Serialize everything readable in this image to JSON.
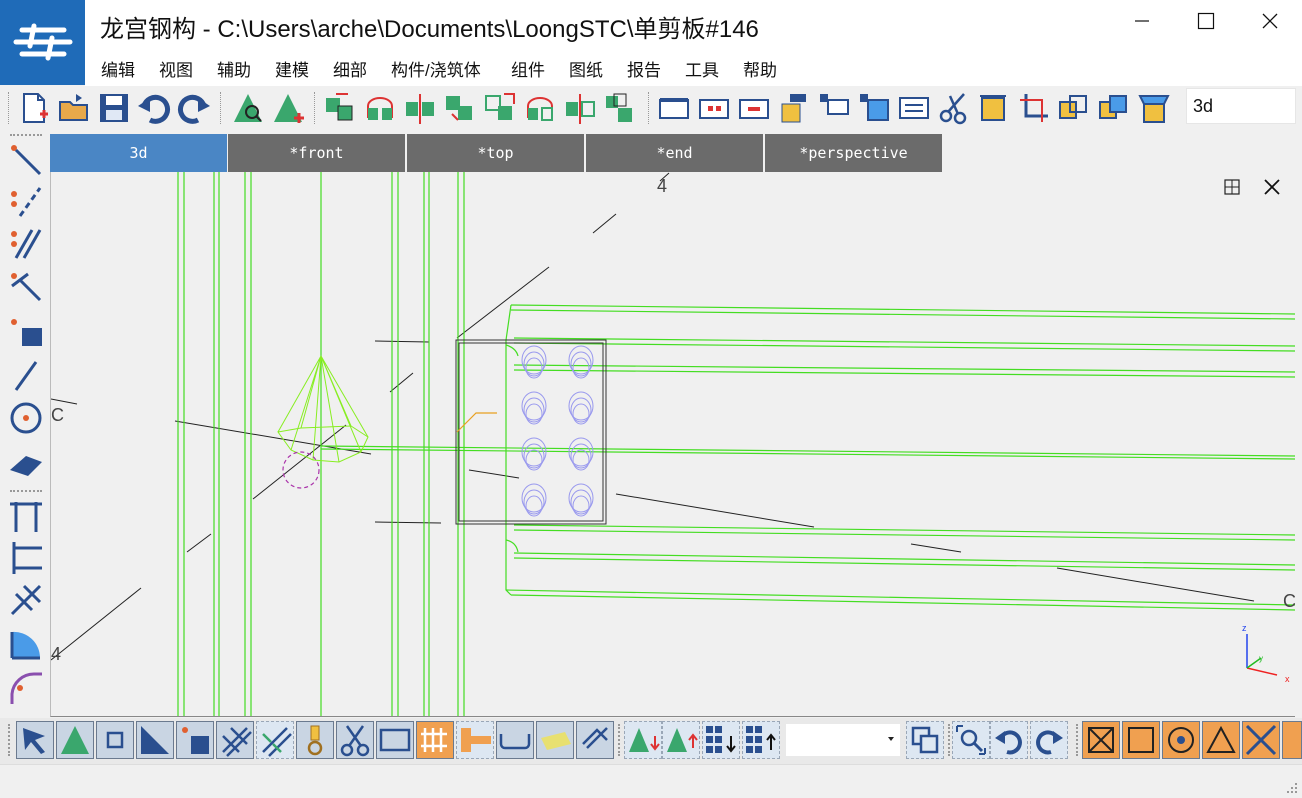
{
  "window": {
    "title": "龙宫钢构 - C:\\Users\\arche\\Documents\\LoongSTC\\单剪板#146"
  },
  "menu": [
    "编辑",
    "视图",
    "辅助",
    "建模",
    "细部",
    "构件/浇筑体",
    "组件",
    "图纸",
    "报告",
    "工具",
    "帮助"
  ],
  "view_selector": {
    "value": "3d"
  },
  "tabs": [
    {
      "label": "3d",
      "active": true
    },
    {
      "label": "*front",
      "active": false
    },
    {
      "label": "*top",
      "active": false
    },
    {
      "label": "*end",
      "active": false
    },
    {
      "label": "*perspective",
      "active": false
    }
  ],
  "viewport": {
    "grid_labels": {
      "top": "4",
      "left_c": "C",
      "bottom_left": "4",
      "right_c": "C"
    },
    "axis_labels": {
      "z": "z",
      "x": "x",
      "y": "y"
    }
  },
  "colors": {
    "brand": "#1f6bb8",
    "active_tab": "#4a86c5",
    "inactive_tab": "#6b6b6b",
    "model_green": "#33dd22",
    "bolt": "#9999ee"
  }
}
